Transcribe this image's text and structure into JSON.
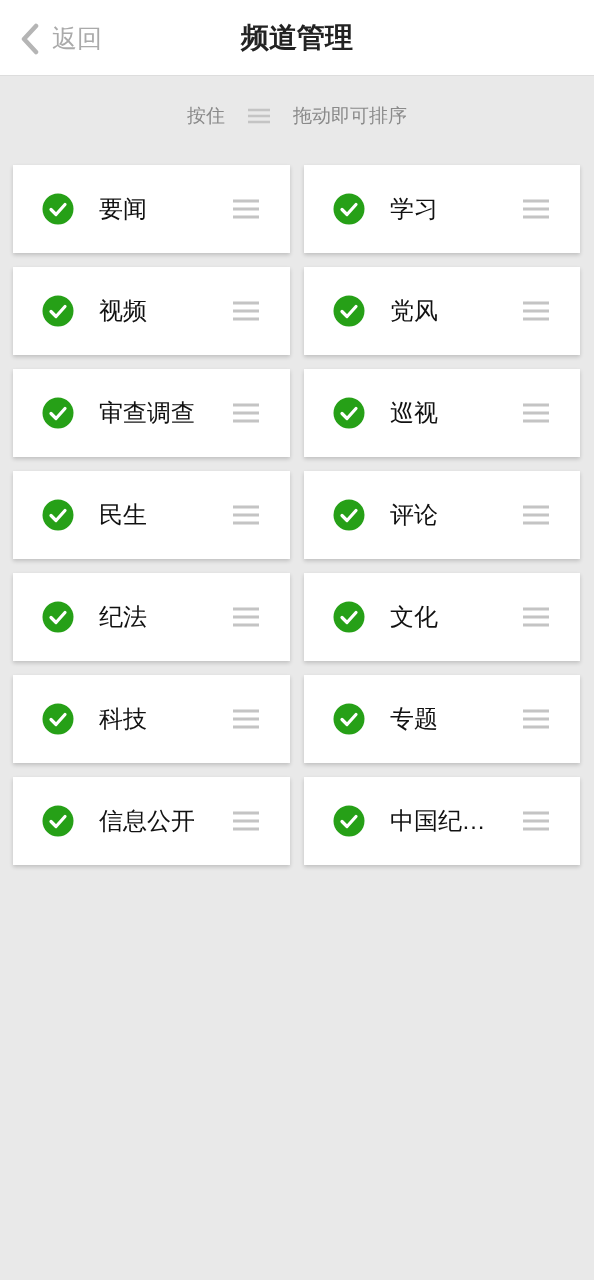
{
  "header": {
    "back_label": "返回",
    "title": "频道管理"
  },
  "hint": {
    "before": "按住",
    "after": "拖动即可排序"
  },
  "channels": [
    {
      "name": "要闻",
      "checked": true
    },
    {
      "name": "学习",
      "checked": true
    },
    {
      "name": "视频",
      "checked": true
    },
    {
      "name": "党风",
      "checked": true
    },
    {
      "name": "审查调查",
      "checked": true
    },
    {
      "name": "巡视",
      "checked": true
    },
    {
      "name": "民生",
      "checked": true
    },
    {
      "name": "评论",
      "checked": true
    },
    {
      "name": "纪法",
      "checked": true
    },
    {
      "name": "文化",
      "checked": true
    },
    {
      "name": "科技",
      "checked": true
    },
    {
      "name": "专题",
      "checked": true
    },
    {
      "name": "信息公开",
      "checked": true
    },
    {
      "name": "中国纪…",
      "checked": true
    }
  ]
}
